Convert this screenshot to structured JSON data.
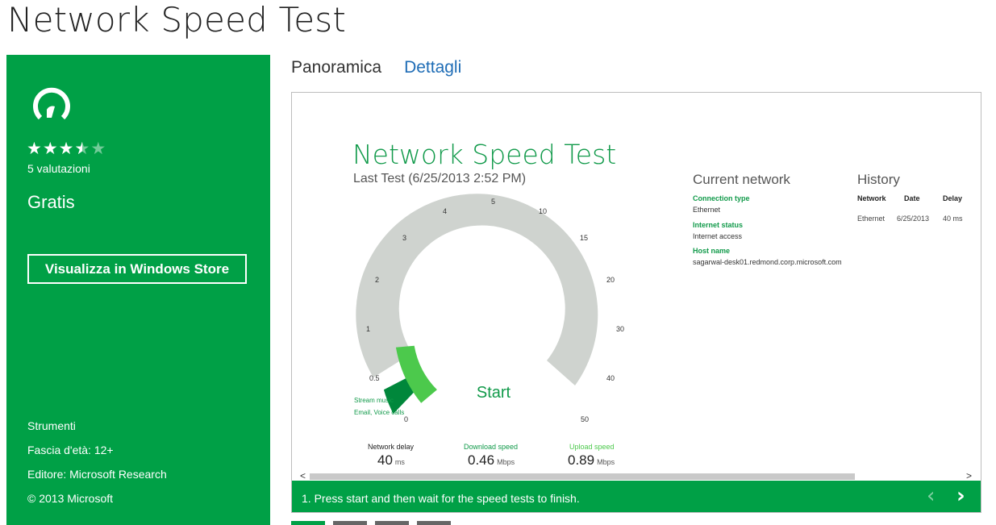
{
  "page": {
    "title": "Network Speed Test"
  },
  "sidebar": {
    "logo_icon": "speedometer-logo-icon",
    "stars_filled": "★★★",
    "stars_half": "★",
    "stars_empty": "★",
    "rating_value": 3.5,
    "rating_count": "5 valutazioni",
    "price": "Gratis",
    "store_button": "Visualizza in Windows Store",
    "category": "Strumenti",
    "age": "Fascia d'età: 12+",
    "publisher": "Editore: Microsoft Research",
    "copyright": "© 2013 Microsoft",
    "bg_color": "#00a046"
  },
  "tabs": {
    "overview": "Panoramica",
    "details": "Dettagli"
  },
  "screenshot": {
    "title": "Network Speed Test",
    "subtitle": "Last Test (6/25/2013 2:52 PM)",
    "gauge": {
      "ticks": [
        "0",
        "0.5",
        "1",
        "2",
        "3",
        "4",
        "5",
        "10",
        "15",
        "20",
        "30",
        "40",
        "50"
      ],
      "start_label": "Start",
      "band_labels": [
        "Stream music",
        "Email, Voice calls"
      ]
    },
    "current_network": {
      "heading": "Current network",
      "items": [
        {
          "label": "Connection type",
          "value": "Ethernet"
        },
        {
          "label": "Internet status",
          "value": "Internet access"
        },
        {
          "label": "Host name",
          "value": "sagarwal-desk01.redmond.corp.microsoft.com"
        }
      ]
    },
    "history": {
      "heading": "History",
      "columns": [
        "Network",
        "Date",
        "Delay"
      ],
      "rows": [
        [
          "Ethernet",
          "6/25/2013",
          "40 ms"
        ]
      ]
    },
    "metrics": [
      {
        "label": "Network delay",
        "value": "40",
        "unit": "ms",
        "color": "#222222"
      },
      {
        "label": "Download speed",
        "value": "0.46",
        "unit": "Mbps",
        "color": "#119a4a"
      },
      {
        "label": "Upload speed",
        "value": "0.89",
        "unit": "Mbps",
        "color": "#4cc94c"
      }
    ],
    "scroll_left": "<",
    "scroll_right": ">",
    "caption": "1. Press start and then wait for the speed tests to finish.",
    "prev_arrow": "‹",
    "next_arrow": "›"
  },
  "thumbnails": {
    "count": 4,
    "selected_index": 0,
    "selected_color": "#00a046",
    "other_color": "#666666"
  }
}
